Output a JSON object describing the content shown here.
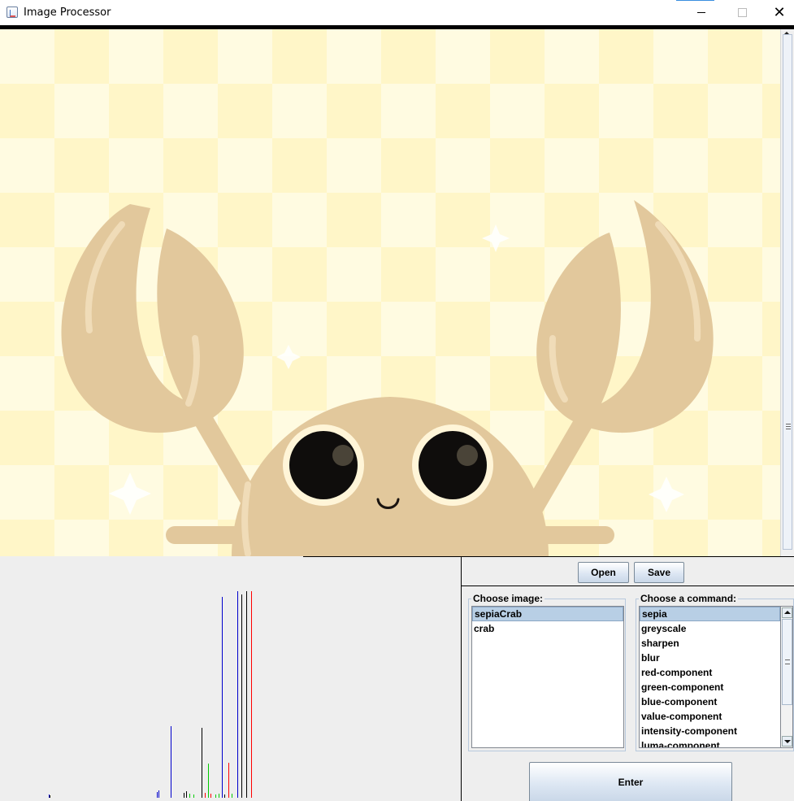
{
  "window": {
    "title": "Image Processor",
    "close_glyph": "✕"
  },
  "toolbar": {
    "open_label": "Open",
    "save_label": "Save"
  },
  "image_panel": {
    "title": "Choose image:",
    "items": [
      "sepiaCrab",
      "crab"
    ],
    "selected": "sepiaCrab"
  },
  "command_panel": {
    "title": "Choose a command:",
    "items": [
      "sepia",
      "greyscale",
      "sharpen",
      "blur",
      "red-component",
      "green-component",
      "blue-component",
      "value-component",
      "intensity-component",
      "luma-component"
    ],
    "selected": "sepia"
  },
  "enter_label": "Enter",
  "colors": {
    "sepia": "#e2c89c",
    "checker_light": "#fffbe1",
    "checker_dark": "#fff6c8",
    "selection": "#b8cfe5",
    "histogram_red": "#ff0000",
    "histogram_green": "#00cc00",
    "histogram_blue": "#0000cc",
    "histogram_black": "#000000"
  },
  "icons": [
    "java-app-icon",
    "minimize-icon",
    "maximize-icon",
    "close-icon",
    "scroll-up-icon",
    "scroll-down-icon"
  ]
}
